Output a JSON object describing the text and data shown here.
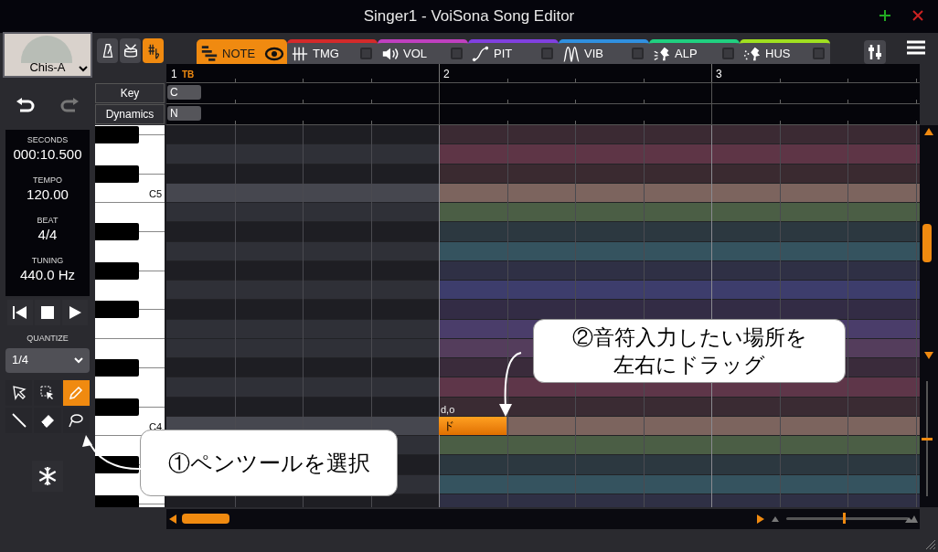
{
  "window": {
    "title": "Singer1 - VoiSona Song Editor"
  },
  "singer": {
    "name": "Chis-A"
  },
  "toolbar_toggles": [
    {
      "selected": false
    },
    {
      "selected": false
    },
    {
      "selected": true
    }
  ],
  "tabs": [
    {
      "label": "NOTE",
      "kind": "eye",
      "color": "#f08a10",
      "selected": true
    },
    {
      "label": "TMG",
      "kind": "checkbox",
      "color": "#d42a2a",
      "selected": false,
      "checked": false
    },
    {
      "label": "VOL",
      "kind": "checkbox",
      "color": "#c040c0",
      "selected": false,
      "checked": false
    },
    {
      "label": "PIT",
      "kind": "checkbox",
      "color": "#8040e0",
      "selected": false,
      "checked": false
    },
    {
      "label": "VIB",
      "kind": "checkbox",
      "color": "#3090e0",
      "selected": false,
      "checked": false
    },
    {
      "label": "ALP",
      "kind": "checkbox",
      "color": "#20d080",
      "selected": false,
      "checked": false
    },
    {
      "label": "HUS",
      "kind": "checkbox",
      "color": "#a0e020",
      "selected": false,
      "checked": false
    }
  ],
  "info": [
    {
      "label": "SECONDS",
      "value": "000:10.500"
    },
    {
      "label": "TEMPO",
      "value": "120.00"
    },
    {
      "label": "BEAT",
      "value": "4/4"
    },
    {
      "label": "TUNING",
      "value": "440.0 Hz"
    }
  ],
  "quantize": {
    "label": "QUANTIZE",
    "value": "1/4"
  },
  "tools": [
    {
      "selected": false
    },
    {
      "selected": false
    },
    {
      "selected": true
    },
    {
      "selected": false
    },
    {
      "selected": false
    },
    {
      "selected": false
    }
  ],
  "measures": [
    {
      "label": "1",
      "marker": "TB",
      "active": false
    },
    {
      "label": "2",
      "active": true
    },
    {
      "label": "3",
      "active": true
    }
  ],
  "track_rows": [
    {
      "label": "Key",
      "value": "C"
    },
    {
      "label": "Dynamics",
      "value": "N"
    }
  ],
  "pitch_rows": [
    {
      "kind": "black",
      "color": "#3b2a33"
    },
    {
      "kind": "white",
      "color": "#5e3546"
    },
    {
      "kind": "black",
      "color": "#3a2a30"
    },
    {
      "kind": "white",
      "color": "#7c645e",
      "label": "C5"
    },
    {
      "kind": "white",
      "color": "#4b5e45"
    },
    {
      "kind": "black",
      "color": "#2c3840"
    },
    {
      "kind": "white",
      "color": "#35535f"
    },
    {
      "kind": "black",
      "color": "#2f3045"
    },
    {
      "kind": "white",
      "color": "#3d3d6c"
    },
    {
      "kind": "black",
      "color": "#332c45"
    },
    {
      "kind": "white",
      "color": "#4a3d6a"
    },
    {
      "kind": "white",
      "color": "#543d5c"
    },
    {
      "kind": "black",
      "color": "#3a2b3b"
    },
    {
      "kind": "white",
      "color": "#5e3649"
    },
    {
      "kind": "black",
      "color": "#3a2b33"
    },
    {
      "kind": "white",
      "color": "#7c645e",
      "label": "C4"
    },
    {
      "kind": "white",
      "color": "#4b5e45"
    },
    {
      "kind": "black",
      "color": "#2c3840"
    },
    {
      "kind": "white",
      "color": "#35535f"
    },
    {
      "kind": "black",
      "color": "#2f3045"
    }
  ],
  "notes": [
    {
      "lyric": "ド",
      "phoneme": "d,o"
    }
  ],
  "callouts": [
    {
      "text": "①ペンツールを選択"
    },
    {
      "text": "②音符入力したい場所を左右にドラッグ"
    }
  ]
}
